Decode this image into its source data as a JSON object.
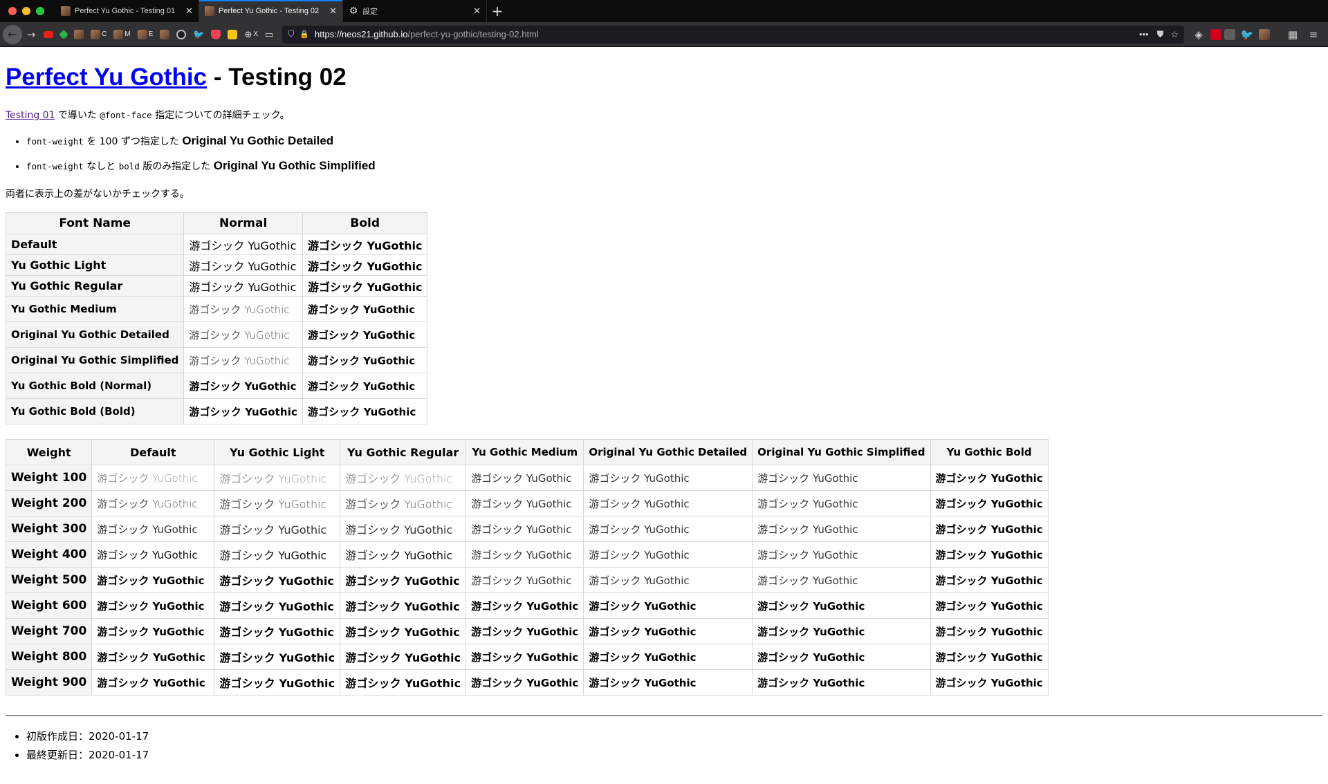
{
  "browser": {
    "tabs": [
      {
        "title": "Perfect Yu Gothic - Testing 01",
        "active": false
      },
      {
        "title": "Perfect Yu Gothic - Testing 02",
        "active": true
      },
      {
        "title": "設定",
        "active": false
      }
    ],
    "bookmarks": [
      "C",
      "M",
      "E",
      "X"
    ],
    "url_host": "https://neos21.github.io",
    "url_path": "/perfect-yu-gothic/testing-02.html"
  },
  "page": {
    "title_link": "Perfect Yu Gothic",
    "title_rest": " - Testing 02",
    "intro": {
      "link": "Testing 01",
      "pre": " で導いた ",
      "code": "@font-face",
      "post": " 指定についての詳細チェック。"
    },
    "options": [
      {
        "code": "font-weight",
        "mid": " を 100 ずつ指定した ",
        "code2": "",
        "strong": "Original Yu Gothic Detailed"
      },
      {
        "code": "font-weight",
        "mid": " なしと ",
        "code2": "bold",
        "mid2": " 版のみ指定した ",
        "strong": "Original Yu Gothic Simplified"
      }
    ],
    "outro": "両者に表示上の差がないかチェックする。",
    "sample": "游ゴシック YuGothic",
    "table1": {
      "headers": [
        "Font Name",
        "Normal",
        "Bold"
      ],
      "rows": [
        "Default",
        "Yu Gothic Light",
        "Yu Gothic Regular",
        "Yu Gothic Medium",
        "Original Yu Gothic Detailed",
        "Original Yu Gothic Simplified",
        "Yu Gothic Bold (Normal)",
        "Yu Gothic Bold (Bold)"
      ]
    },
    "table2": {
      "headers": [
        "Weight",
        "Default",
        "Yu Gothic Light",
        "Yu Gothic Regular",
        "Yu Gothic Medium",
        "Original Yu Gothic Detailed",
        "Original Yu Gothic Simplified",
        "Yu Gothic Bold"
      ],
      "rows": [
        "Weight 100",
        "Weight 200",
        "Weight 300",
        "Weight 400",
        "Weight 500",
        "Weight 600",
        "Weight 700",
        "Weight 800",
        "Weight 900"
      ]
    },
    "footer": [
      "初版作成日：2020-01-17",
      "最終更新日：2020-01-17"
    ]
  }
}
